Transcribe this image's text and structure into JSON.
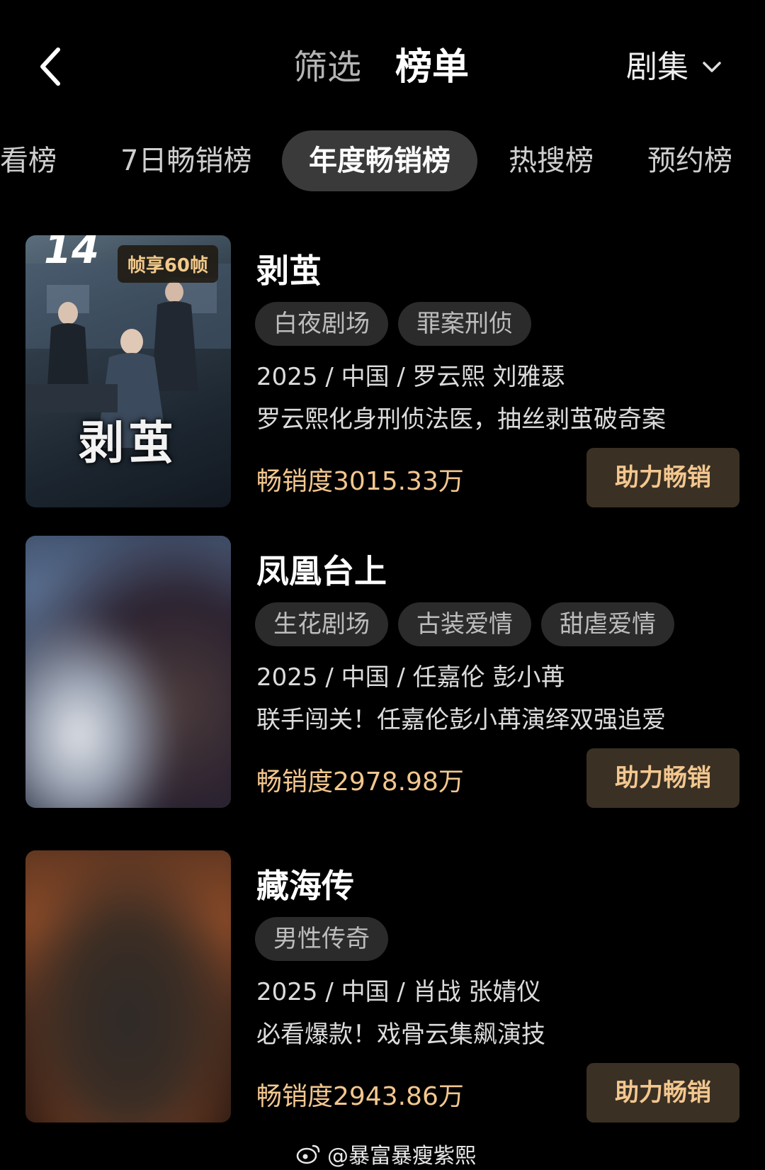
{
  "header": {
    "filter_tab": "筛选",
    "rank_tab": "榜单",
    "category": "剧集"
  },
  "rank_tabs": [
    "必看榜",
    "7日畅销榜",
    "年度畅销榜",
    "热搜榜",
    "预约榜"
  ],
  "active_rank_tab": "年度畅销榜",
  "items": [
    {
      "poster_rank": "14",
      "poster_badge": "帧享60帧",
      "poster_title": "剥茧",
      "title": "剥茧",
      "tags": [
        "白夜剧场",
        "罪案刑侦"
      ],
      "meta": "2025 / 中国 / 罗云熙 刘雅瑟",
      "desc": "罗云熙化身刑侦法医，抽丝剥茧破奇案",
      "sales": "畅销度3015.33万",
      "button": "助力畅销"
    },
    {
      "title": "凤凰台上",
      "tags": [
        "生花剧场",
        "古装爱情",
        "甜虐爱情"
      ],
      "meta": "2025 / 中国 / 任嘉伦 彭小苒",
      "desc": "联手闯关！任嘉伦彭小苒演绎双强追爱",
      "sales": "畅销度2978.98万",
      "button": "助力畅销"
    },
    {
      "title": "藏海传",
      "tags": [
        "男性传奇"
      ],
      "meta": "2025 / 中国 / 肖战 张婧仪",
      "desc": "必看爆款！戏骨云集飙演技",
      "sales": "畅销度2943.86万",
      "button": "助力畅销"
    }
  ],
  "watermark": "@暴富暴瘦紫熙",
  "colors": {
    "background": "#000000",
    "sales_text": "#f3c78f",
    "button_bg": "#3a3024",
    "tag_bg": "#2b2b2b",
    "active_tab_bg": "#3a3a3a"
  }
}
